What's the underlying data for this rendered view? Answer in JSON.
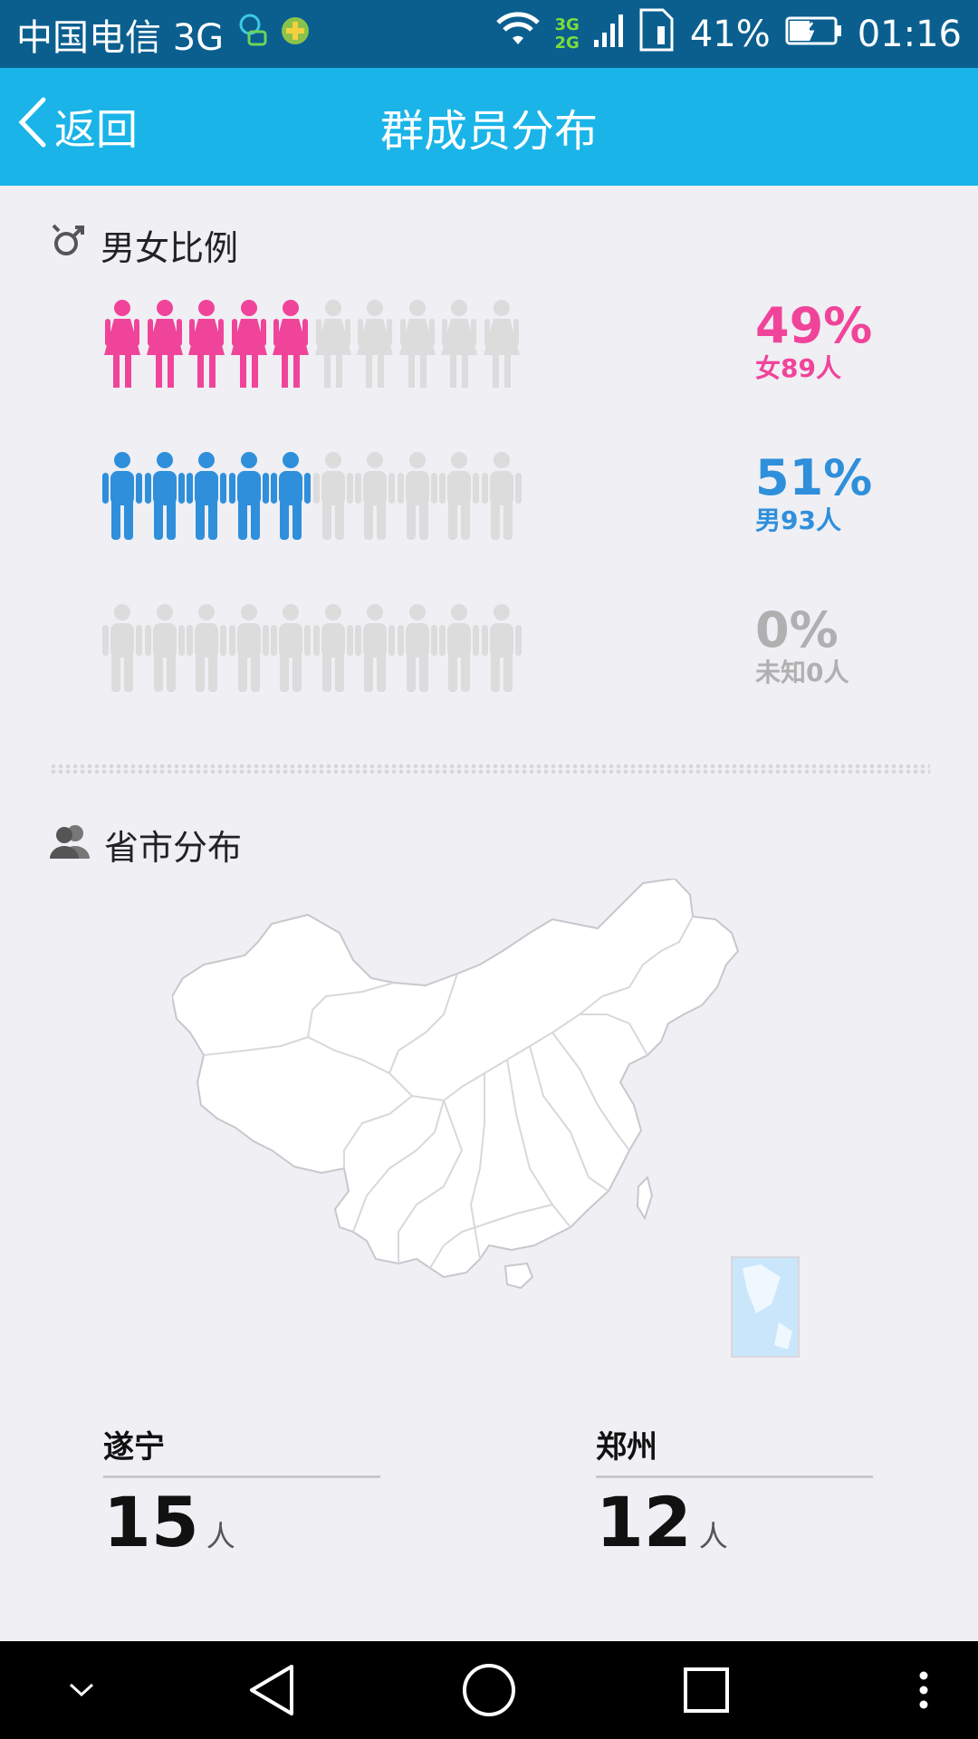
{
  "status_bar": {
    "carrier": "中国电信 3G",
    "net_top": "3G",
    "net_bottom": "2G",
    "battery": "41%",
    "time": "01:16"
  },
  "nav": {
    "back_label": "返回",
    "title": "群成员分布"
  },
  "gender_section": {
    "title": "男女比例",
    "rows": [
      {
        "key": "female",
        "percent": "49%",
        "count_label": "女89人",
        "filled_icons": 5,
        "total_icons": 10,
        "color": "#f0449a"
      },
      {
        "key": "male",
        "percent": "51%",
        "count_label": "男93人",
        "filled_icons": 5,
        "total_icons": 10,
        "color": "#2f8fdb"
      },
      {
        "key": "unknown",
        "percent": "0%",
        "count_label": "未知0人",
        "filled_icons": 0,
        "total_icons": 10,
        "color": "#b0b0b0"
      }
    ],
    "inactive_color": "#dcdcdc"
  },
  "region_section": {
    "title": "省市分布",
    "cities": [
      {
        "name": "遂宁",
        "count": "15",
        "unit": "人"
      },
      {
        "name": "郑州",
        "count": "12",
        "unit": "人"
      }
    ]
  },
  "colors": {
    "status_bar": "#0a5f8f",
    "nav_bar": "#1ab4e8",
    "page_bg": "#efeff4"
  }
}
